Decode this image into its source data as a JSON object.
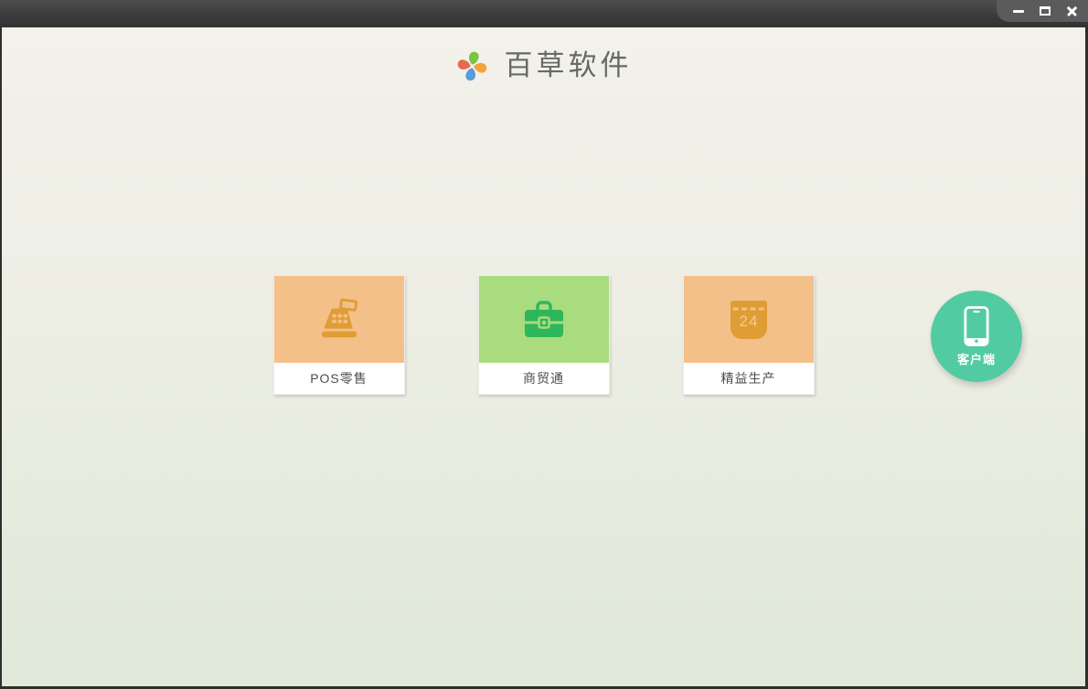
{
  "window": {
    "controls": [
      {
        "name": "minimize",
        "icon": "minimize-icon"
      },
      {
        "name": "maximize",
        "icon": "maximize-icon"
      },
      {
        "name": "close",
        "icon": "close-icon"
      }
    ]
  },
  "header": {
    "app_name": "百草软件",
    "logo_icon": "pinwheel-icon",
    "logo_petal_colors": [
      "#7cc243",
      "#f2a33a",
      "#5b9bd8",
      "#e66a4d"
    ]
  },
  "products": [
    {
      "label": "POS零售",
      "icon": "cash-register-icon",
      "tile_color": "#f4c08a",
      "icon_color": "#df9d35"
    },
    {
      "label": "商贸通",
      "icon": "briefcase-icon",
      "tile_color": "#a9db7f",
      "icon_color": "#2fb75b"
    },
    {
      "label": "精益生产",
      "icon": "calendar-icon",
      "tile_color": "#f4c08a",
      "icon_color": "#df9d35",
      "calendar_day": "24"
    }
  ],
  "client_button": {
    "label": "客户端",
    "icon": "smartphone-icon",
    "color": "#52cba2"
  },
  "theme": {
    "background_top": "#f2f1ea",
    "background_bottom": "#dfe8d9",
    "titlebar_top": "#4d4d4d",
    "titlebar_bottom": "#323232",
    "card_label_text": "#4d4d4d",
    "logo_text": "#686868"
  }
}
